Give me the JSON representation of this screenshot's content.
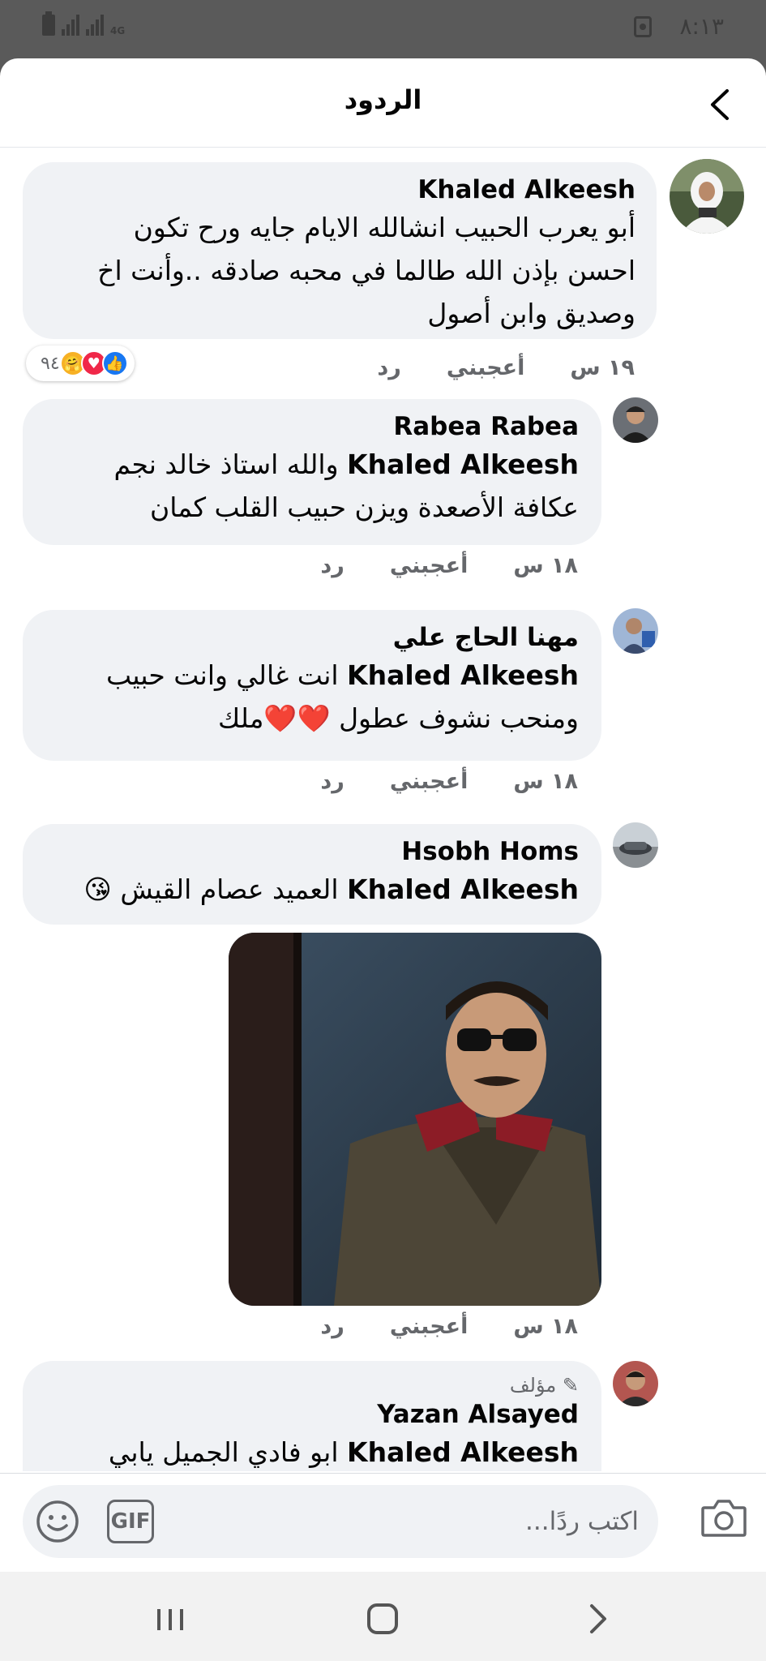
{
  "status_bar": {
    "network": "4G",
    "time": "٨:١٣"
  },
  "header": {
    "title": "الردود",
    "back_icon": "chevron-left-icon"
  },
  "comments": [
    {
      "author": "Khaled Alkeesh",
      "text_lines": [
        "أبو يعرب الحبيب انشالله الايام جايه ورح تكون",
        "احسن بإذن الله طالما في محبه صادقه ..وأنت اخ",
        "وصديق وابن أصول"
      ],
      "time": "١٩ س",
      "like": "أعجبني",
      "reply": "رد",
      "reactions": {
        "icons": [
          "like-icon",
          "love-icon",
          "care-icon"
        ],
        "count": "٩٤"
      }
    },
    {
      "author": "Rabea Rabea",
      "mention": "Khaled Alkeesh",
      "text_line1": "والله استاذ خالد نجم",
      "text_line2": "عكافة الأصعدة ويزن حبيب القلب كمان",
      "time": "١٨ س",
      "like": "أعجبني",
      "reply": "رد"
    },
    {
      "author": "مهنا الحاج علي",
      "mention": "Khaled Alkeesh",
      "text_line1": "انت غالي وانت حبيب",
      "text_line2": "ومنحب نشوف عطول ❤️❤️ملك",
      "time": "١٨ س",
      "like": "أعجبني",
      "reply": "رد"
    },
    {
      "author": "Hsobh Homs",
      "mention": "Khaled Alkeesh",
      "text_line1": "العميد عصام القيش 😘",
      "time": "١٨ س",
      "like": "أعجبني",
      "reply": "رد"
    },
    {
      "author_tag": "مؤلف",
      "author": "Yazan Alsayed",
      "mention": "Khaled Alkeesh",
      "text_line1": "ابو فادي الجميل يابي"
    }
  ],
  "composer": {
    "placeholder": "اكتب ردًا...",
    "gif_label": "GIF"
  },
  "colors": {
    "bubble": "#f0f2f5",
    "secondary_text": "#65676b",
    "like_blue": "#1877f2",
    "love_red": "#f02849"
  }
}
